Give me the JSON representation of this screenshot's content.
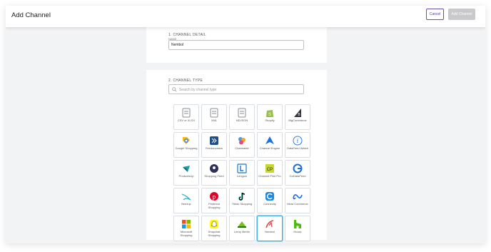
{
  "header": {
    "title": "Add Channel",
    "cancel_label": "Cancel",
    "add_label": "Add Channel"
  },
  "detail": {
    "section_title": "1. CHANNEL DETAIL",
    "name_label": "NAME",
    "name_value": "Nembol"
  },
  "type": {
    "section_title": "2. CHANNEL TYPE",
    "search_placeholder": "Search by channel type"
  },
  "channels": [
    {
      "label": "CSV or XLSX",
      "icon": "file-csv-icon",
      "color": "#8a8f96"
    },
    {
      "label": "XML",
      "icon": "file-xml-icon",
      "color": "#8a8f96"
    },
    {
      "label": "NDJSON",
      "icon": "file-json-icon",
      "color": "#8a8f96"
    },
    {
      "label": "Shopify",
      "icon": "shopify-icon",
      "color": "#95bf47"
    },
    {
      "label": "BigCommerce",
      "icon": "bigcommerce-icon",
      "color": "#34313f"
    },
    {
      "label": "Google Shopping",
      "icon": "google-shopping-icon",
      "color": "#4285f4"
    },
    {
      "label": "Feedonomics",
      "icon": "feedonomics-icon",
      "color": "#1f4e8c"
    },
    {
      "label": "Channable",
      "icon": "channable-icon",
      "color": "#f5a623"
    },
    {
      "label": "Channel Engine",
      "icon": "channel-engine-icon",
      "color": "#1e6fd9"
    },
    {
      "label": "DataFeed Watch",
      "icon": "datafeed-watch-icon",
      "color": "#2b7de9"
    },
    {
      "label": "ProductsUp",
      "icon": "productsup-icon",
      "color": "#1aa0a8"
    },
    {
      "label": "Shopping Feed",
      "icon": "shopping-feed-icon",
      "color": "#2a2f5c"
    },
    {
      "label": "Lengow",
      "icon": "lengow-icon",
      "color": "#1a75c9"
    },
    {
      "label": "Channel Pilot Pro",
      "icon": "channel-pilot-icon",
      "color": "#c6d82d"
    },
    {
      "label": "GoDataFeed",
      "icon": "godatafeed-icon",
      "color": "#1b6fd6"
    },
    {
      "label": "Beezup",
      "icon": "beezup-icon",
      "color": "#2bb5c8"
    },
    {
      "label": "Pinterest Shopping",
      "icon": "pinterest-icon",
      "color": "#e60023"
    },
    {
      "label": "Tiktok Shopping",
      "icon": "tiktok-icon",
      "color": "#111111"
    },
    {
      "label": "Connexity",
      "icon": "connexity-icon",
      "color": "#1e88e5"
    },
    {
      "label": "Meta Commerce",
      "icon": "meta-icon",
      "color": "#0866ff"
    },
    {
      "label": "Microsoft Shopping",
      "icon": "microsoft-icon",
      "color": "#f25022"
    },
    {
      "label": "Snapchat Shopping",
      "icon": "snapchat-icon",
      "color": "#fffc00"
    },
    {
      "label": "Leroy Merlin",
      "icon": "leroy-merlin-icon",
      "color": "#78be20"
    },
    {
      "label": "Nembol",
      "icon": "nembol-icon",
      "color": "#e24a4a",
      "selected": true
    },
    {
      "label": "Houzz",
      "icon": "houzz-icon",
      "color": "#4dbc15"
    }
  ]
}
